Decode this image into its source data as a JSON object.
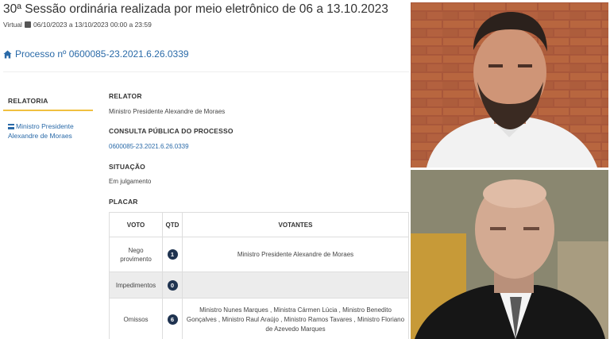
{
  "session": {
    "title": "30ª Sessão ordinária realizada por meio eletrônico de 06 a 13.10.2023",
    "virtual_label": "Virtual",
    "dates": "06/10/2023 a 13/10/2023 00:00 a 23:59"
  },
  "processo": {
    "text": "Processo nº 0600085-23.2021.6.26.0339"
  },
  "sidebar": {
    "tab": "RELATORIA",
    "link": "Ministro Presidente Alexandre de Moraes"
  },
  "details": {
    "relator_label": "RELATOR",
    "relator_value": "Ministro Presidente Alexandre de Moraes",
    "consulta_label": "CONSULTA PÚBLICA DO PROCESSO",
    "consulta_value": "0600085-23.2021.6.26.0339",
    "situacao_label": "SITUAÇÃO",
    "situacao_value": "Em julgamento",
    "placar_label": "PLACAR"
  },
  "placar": {
    "headers": [
      "VOTO",
      "QTD",
      "VOTANTES"
    ],
    "rows": [
      {
        "voto": "Nego provimento",
        "qtd": "1",
        "votantes": "Ministro Presidente Alexandre de Moraes"
      },
      {
        "voto": "Impedimentos",
        "qtd": "0",
        "votantes": ""
      },
      {
        "voto": "Omissos",
        "qtd": "6",
        "votantes": "Ministro Nunes Marques , Ministra Cármen Lúcia , Ministro Benedito Gonçalves , Ministro Raul Araújo , Ministro Ramos Tavares , Ministro Floriano de Azevedo Marques"
      }
    ]
  },
  "colors": {
    "link": "#2a6aa8",
    "accent": "#f0c040",
    "badge": "#1f3350"
  },
  "icons": [
    "calendar-icon",
    "home-icon",
    "list-icon"
  ]
}
